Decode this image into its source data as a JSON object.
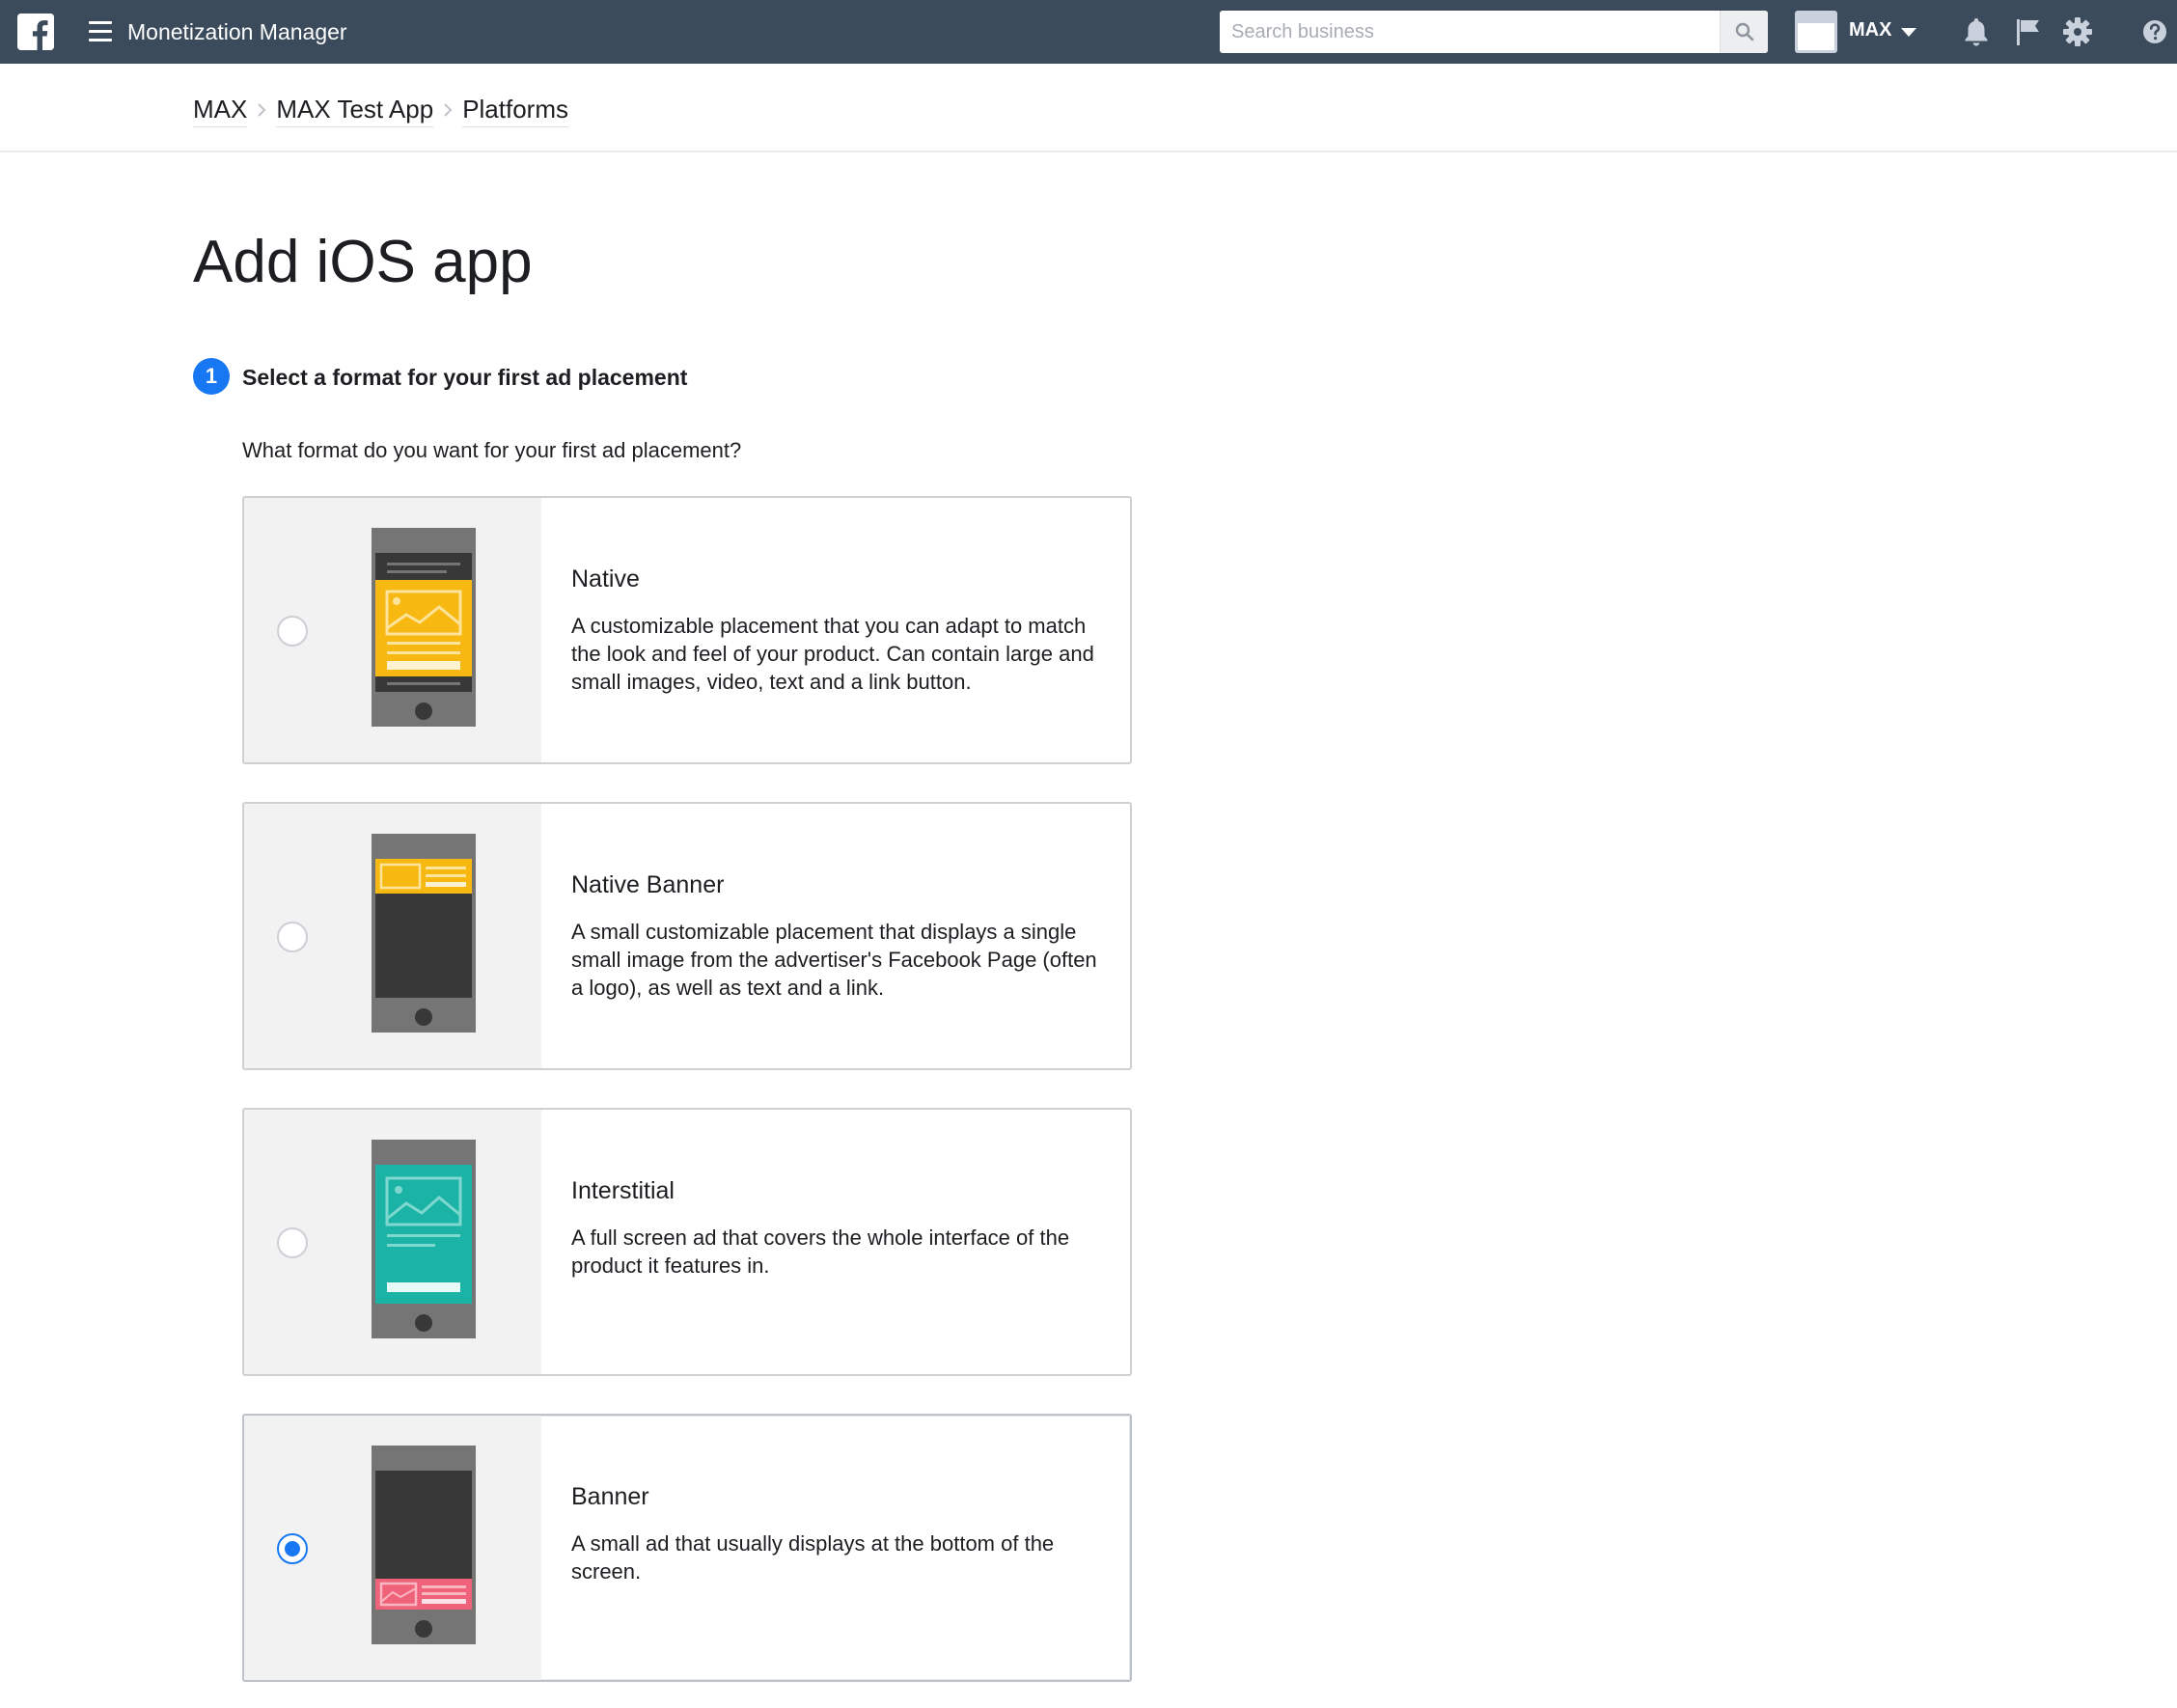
{
  "topbar": {
    "app_title": "Monetization Manager",
    "search_placeholder": "Search business",
    "business_name": "MAX",
    "icons": [
      "facebook-logo",
      "hamburger-menu-icon",
      "search-icon",
      "bell-icon",
      "flag-icon",
      "gear-icon",
      "help-icon"
    ]
  },
  "breadcrumb": [
    {
      "label": "MAX"
    },
    {
      "label": "MAX Test App"
    },
    {
      "label": "Platforms"
    }
  ],
  "page": {
    "title": "Add iOS app"
  },
  "step": {
    "number": "1",
    "title": "Select a format for your first ad placement",
    "question": "What format do you want for your first ad placement?"
  },
  "formats": [
    {
      "id": "native",
      "title": "Native",
      "description": "A customizable placement that you can adapt to match the look and feel of your product. Can contain large and small images, video, text and a link button.",
      "selected": false,
      "accent_color": "#f7b911"
    },
    {
      "id": "native-banner",
      "title": "Native Banner",
      "description": "A small customizable placement that displays a single small image from the advertiser's Facebook Page (often a logo), as well as text and a link.",
      "selected": false,
      "accent_color": "#f7b911"
    },
    {
      "id": "interstitial",
      "title": "Interstitial",
      "description": "A full screen ad that covers the whole interface of the product it features in.",
      "selected": false,
      "accent_color": "#1ab3a6"
    },
    {
      "id": "banner",
      "title": "Banner",
      "description": "A small ad that usually displays at the bottom of the screen.",
      "selected": true,
      "accent_color": "#f0627a"
    }
  ],
  "colors": {
    "topbar_bg": "#3b4b5c",
    "primary_blue": "#1877f2",
    "phone_body": "#757575",
    "phone_screen": "#383838"
  }
}
